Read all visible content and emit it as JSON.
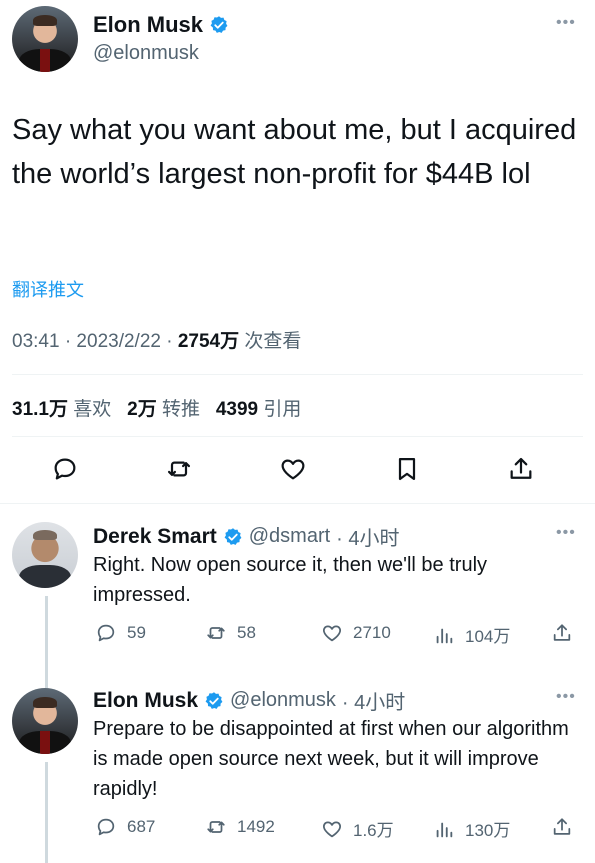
{
  "main_tweet": {
    "author_name": "Elon Musk",
    "author_handle": "@elonmusk",
    "text": "Say what you want about me, but I acquired the world’s largest non-profit for $44B lol",
    "translate_label": "翻译推文",
    "time": "03:41 · 2023/2/22 · ",
    "views_count": "2754万",
    "views_label": " 次查看",
    "likes_count": "31.1万",
    "likes_label": "喜欢",
    "retweets_count": "2万",
    "retweets_label": "转推",
    "quotes_count": "4399",
    "quotes_label": "引用"
  },
  "replies": [
    {
      "author_name": "Derek Smart",
      "author_handle": "@dsmart",
      "time": " · 4小时",
      "text": "Right. Now open source it, then we'll be truly impressed.",
      "reply_count": "59",
      "retweet_count": "58",
      "like_count": "2710",
      "view_count": "104万"
    },
    {
      "author_name": "Elon Musk",
      "author_handle": "@elonmusk",
      "time": " · 4小时",
      "text": "Prepare to be disappointed at first when our algorithm is made open source next week, but it will improve rapidly!",
      "reply_count": "687",
      "retweet_count": "1492",
      "like_count": "1.6万",
      "view_count": "130万"
    }
  ],
  "icons": {
    "verified": "verified-badge-icon",
    "more": "more-options-icon",
    "reply": "reply-icon",
    "retweet": "retweet-icon",
    "like": "like-icon",
    "bookmark": "bookmark-icon",
    "share": "share-icon",
    "views": "views-icon"
  },
  "colors": {
    "accent": "#1d9bf0",
    "secondary_text": "#536471",
    "primary_text": "#0f1419"
  }
}
